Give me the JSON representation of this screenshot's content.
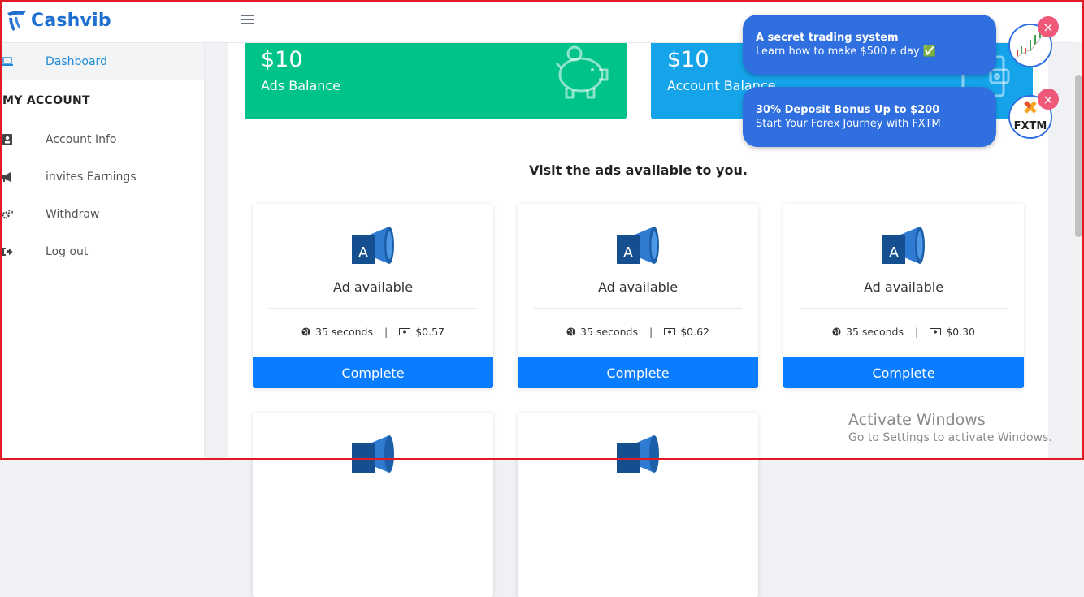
{
  "brand": {
    "name": "Cashvib",
    "accent": "#1f6fd1"
  },
  "sidebar": {
    "dashboard": {
      "label": "Dashboard",
      "icon": "laptop-icon"
    },
    "section": "MY ACCOUNT",
    "items": [
      {
        "label": "Account Info",
        "icon": "id-card-icon"
      },
      {
        "label": "invites Earnings",
        "icon": "megaphone-icon"
      },
      {
        "label": "Withdraw",
        "icon": "gears-icon"
      },
      {
        "label": "Log out",
        "icon": "sign-out-icon"
      }
    ]
  },
  "balances": [
    {
      "amount": "$10",
      "label": "Ads Balance",
      "color": "#00c38a",
      "icon": "piggy-bank-icon"
    },
    {
      "amount": "$10",
      "label": "Account Balance",
      "color": "#15a4ea",
      "icon": "wallet-icon"
    }
  ],
  "ads_heading": "Visit the ads available to you.",
  "ads": [
    {
      "title": "Ad available",
      "duration": "35 seconds",
      "separator": "|",
      "reward": "$0.57",
      "button": "Complete"
    },
    {
      "title": "Ad available",
      "duration": "35 seconds",
      "separator": "|",
      "reward": "$0.62",
      "button": "Complete"
    },
    {
      "title": "Ad available",
      "duration": "35 seconds",
      "separator": "|",
      "reward": "$0.30",
      "button": "Complete"
    }
  ],
  "notifications": [
    {
      "title": "A secret trading system",
      "body": "Learn how to make $500 a day ✅",
      "close": "×"
    },
    {
      "title": "30% Deposit Bonus Up to $200",
      "body": "Start Your Forex Journey with FXTM",
      "close": "×",
      "logo_text": "FXTM"
    }
  ],
  "watermark": {
    "line1": "Activate Windows",
    "line2": "Go to Settings to activate Windows."
  }
}
